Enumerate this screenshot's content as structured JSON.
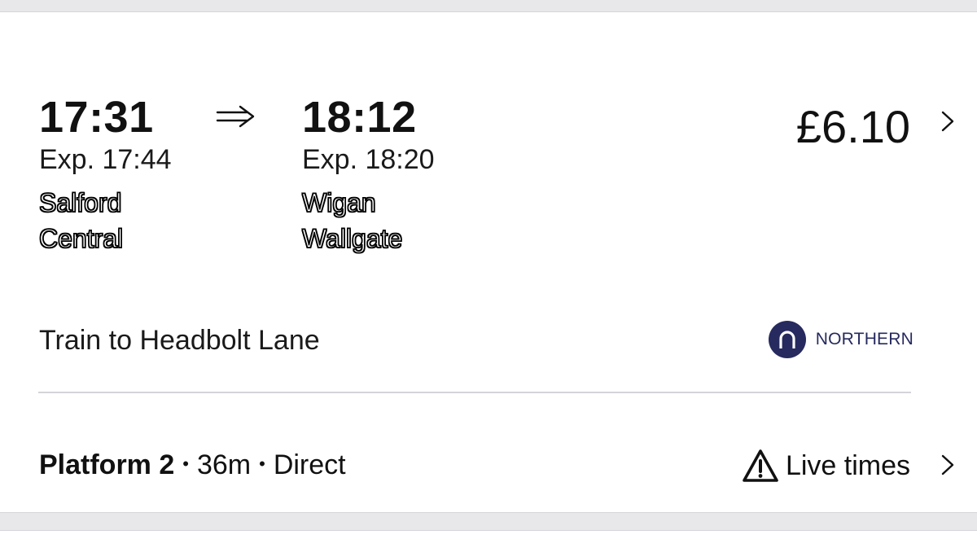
{
  "journey": {
    "departure_time": "17:31",
    "departure_expected": "Exp. 17:44",
    "departure_station_line1": "Salford",
    "departure_station_line2": "Central",
    "arrival_time": "18:12",
    "arrival_expected": "Exp. 18:20",
    "arrival_station_line1": "Wigan",
    "arrival_station_line2": "Wallgate",
    "price": "£6.10",
    "arrow_icon": "double-arrow-right-icon",
    "chevron_icon": "chevron-right-icon"
  },
  "service": {
    "train_to": "Train to Headbolt Lane",
    "operator_name": "NORTHERN",
    "operator_logo_icon": "northern-logo-icon",
    "operator_color": "#262a5e"
  },
  "details": {
    "platform": "Platform 2",
    "duration": "36m",
    "changes": "Direct",
    "separator": "•",
    "live_times_label": "Live times",
    "warning_icon": "warning-triangle-icon"
  }
}
